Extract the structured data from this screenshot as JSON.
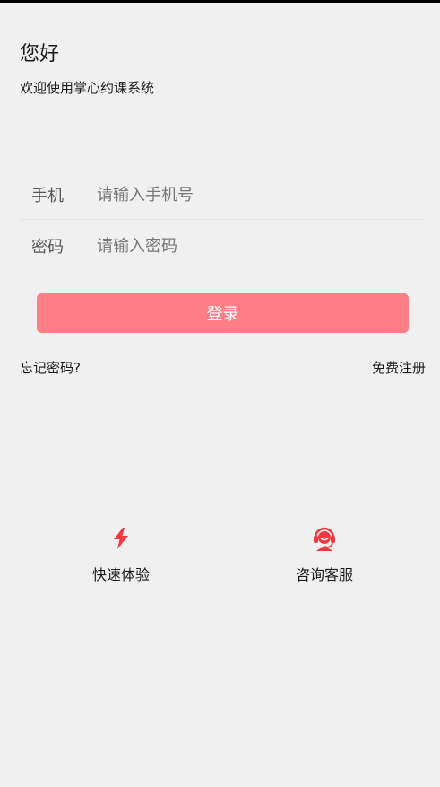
{
  "header": {
    "greeting": "您好",
    "welcome": "欢迎使用掌心约课系统"
  },
  "form": {
    "phone_label": "手机",
    "phone_placeholder": "请输入手机号",
    "password_label": "密码",
    "password_placeholder": "请输入密码",
    "login_label": "登录"
  },
  "links": {
    "forgot": "忘记密码?",
    "register": "免费注册"
  },
  "actions": [
    {
      "label": "快速体验",
      "icon": "lightning-icon"
    },
    {
      "label": "咨询客服",
      "icon": "customer-service-icon"
    }
  ],
  "colors": {
    "accent": "#ff7f86",
    "icon": "#f03a3f",
    "background": "#f0f0f0"
  }
}
